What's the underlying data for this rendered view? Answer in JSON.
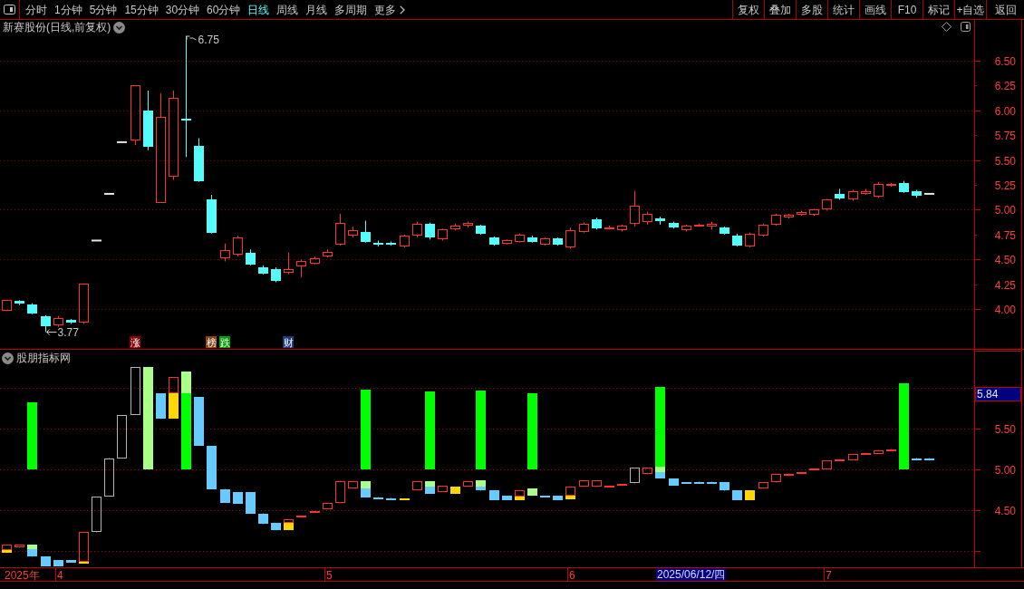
{
  "toolbar": {
    "tabs": [
      {
        "label": "分时",
        "selected": false,
        "kind": "period"
      },
      {
        "label": "1分钟",
        "selected": false,
        "kind": "period"
      },
      {
        "label": "5分钟",
        "selected": false,
        "kind": "period"
      },
      {
        "label": "15分钟",
        "selected": false,
        "kind": "period"
      },
      {
        "label": "30分钟",
        "selected": false,
        "kind": "period"
      },
      {
        "label": "60分钟",
        "selected": false,
        "kind": "period"
      },
      {
        "label": "日线",
        "selected": true,
        "kind": "period"
      },
      {
        "label": "周线",
        "selected": false,
        "kind": "period"
      },
      {
        "label": "月线",
        "selected": false,
        "kind": "period"
      },
      {
        "label": "多周期",
        "selected": false,
        "kind": "period"
      },
      {
        "label": "更多",
        "selected": false,
        "kind": "menu"
      }
    ],
    "buttons": [
      "复权",
      "叠加",
      "多股",
      "统计",
      "画线",
      "F10",
      "标记",
      "+自选",
      "返回"
    ]
  },
  "main_pane": {
    "title": "新赛股份(日线,前复权)",
    "high_label": "6.75",
    "low_label": "3.77",
    "event_tags": [
      {
        "color": "#8b0000"
      },
      {
        "color": "#8b4513"
      },
      {
        "color": "#00a000"
      },
      {
        "color": "#1e3a7a"
      }
    ],
    "chart_data": {
      "type": "candlestick",
      "ylim": [
        3.6,
        6.91
      ],
      "yticks": [
        {
          "value": 4,
          "label": "4.00"
        },
        {
          "value": 4.25,
          "label": "4.25"
        },
        {
          "value": 4.5,
          "label": "4.50"
        },
        {
          "value": 4.75,
          "label": "4.75"
        },
        {
          "value": 5,
          "label": "5.00"
        },
        {
          "value": 5.25,
          "label": "5.25"
        },
        {
          "value": 5.5,
          "label": "5.50"
        },
        {
          "value": 5.75,
          "label": "5.75"
        },
        {
          "value": 6,
          "label": "6.00"
        },
        {
          "value": 6.25,
          "label": "6.25"
        },
        {
          "value": 6.5,
          "label": "6.50"
        }
      ],
      "grid": true,
      "categories": [
        null,
        null,
        null,
        null,
        null,
        null,
        null,
        null,
        null,
        null,
        "涨",
        null,
        null,
        null,
        null,
        null,
        "榜",
        "跌",
        null,
        null,
        null,
        null,
        "财",
        null,
        null,
        null,
        null,
        null,
        null,
        null,
        null,
        null,
        null,
        null,
        null,
        null,
        null,
        null,
        null,
        null,
        null,
        null,
        null,
        null,
        null,
        null,
        null,
        null,
        null,
        null,
        null,
        null,
        null,
        null,
        null,
        null,
        null,
        null,
        null,
        null,
        null,
        null,
        null,
        null,
        null,
        null,
        null,
        null,
        null,
        null,
        null,
        null,
        null,
        null,
        null,
        null
      ],
      "ohlc": [
        [
          3.98,
          4.09,
          3.98,
          4.09
        ],
        [
          4.08,
          4.09,
          4.04,
          4.06
        ],
        [
          4.05,
          4.06,
          3.95,
          3.96
        ],
        [
          3.93,
          3.94,
          3.77,
          3.83
        ],
        [
          3.84,
          3.93,
          3.82,
          3.91
        ],
        [
          3.89,
          3.9,
          3.85,
          3.86
        ],
        [
          3.86,
          4.26,
          3.85,
          4.26
        ],
        [
          4.69,
          4.69,
          4.69,
          4.69
        ],
        [
          5.16,
          5.16,
          5.16,
          5.16
        ],
        [
          5.68,
          5.68,
          5.68,
          5.68
        ],
        [
          5.7,
          6.25,
          5.65,
          6.25
        ],
        [
          6.0,
          6.2,
          5.6,
          5.63
        ],
        [
          5.07,
          6.17,
          5.07,
          5.93
        ],
        [
          5.33,
          6.2,
          5.3,
          6.13
        ],
        [
          5.92,
          6.75,
          5.53,
          5.9
        ],
        [
          5.64,
          5.72,
          5.28,
          5.29
        ],
        [
          5.1,
          5.15,
          4.76,
          4.77
        ],
        [
          4.51,
          4.66,
          4.48,
          4.59
        ],
        [
          4.55,
          4.74,
          4.53,
          4.72
        ],
        [
          4.57,
          4.6,
          4.44,
          4.45
        ],
        [
          4.42,
          4.44,
          4.35,
          4.36
        ],
        [
          4.4,
          4.42,
          4.27,
          4.28
        ],
        [
          4.37,
          4.57,
          4.35,
          4.4
        ],
        [
          4.43,
          4.5,
          4.32,
          4.48
        ],
        [
          4.46,
          4.53,
          4.45,
          4.51
        ],
        [
          4.53,
          4.6,
          4.52,
          4.58
        ],
        [
          4.65,
          4.96,
          4.64,
          4.87
        ],
        [
          4.74,
          4.83,
          4.72,
          4.79
        ],
        [
          4.78,
          4.89,
          4.67,
          4.68
        ],
        [
          4.67,
          4.69,
          4.63,
          4.66
        ],
        [
          4.67,
          4.68,
          4.64,
          4.66
        ],
        [
          4.63,
          4.75,
          4.62,
          4.74
        ],
        [
          4.74,
          4.88,
          4.72,
          4.86
        ],
        [
          4.86,
          4.87,
          4.7,
          4.72
        ],
        [
          4.7,
          4.81,
          4.69,
          4.8
        ],
        [
          4.8,
          4.86,
          4.79,
          4.84
        ],
        [
          4.84,
          4.88,
          4.82,
          4.87
        ],
        [
          4.84,
          4.85,
          4.75,
          4.76
        ],
        [
          4.72,
          4.73,
          4.64,
          4.65
        ],
        [
          4.66,
          4.7,
          4.65,
          4.69
        ],
        [
          4.68,
          4.76,
          4.67,
          4.75
        ],
        [
          4.72,
          4.74,
          4.67,
          4.68
        ],
        [
          4.65,
          4.72,
          4.64,
          4.71
        ],
        [
          4.71,
          4.72,
          4.64,
          4.65
        ],
        [
          4.62,
          4.82,
          4.61,
          4.79
        ],
        [
          4.78,
          4.87,
          4.77,
          4.86
        ],
        [
          4.9,
          4.92,
          4.8,
          4.81
        ],
        [
          4.81,
          4.84,
          4.8,
          4.82
        ],
        [
          4.79,
          4.85,
          4.78,
          4.84
        ],
        [
          4.86,
          5.19,
          4.83,
          5.04
        ],
        [
          4.88,
          4.98,
          4.85,
          4.96
        ],
        [
          4.91,
          4.93,
          4.85,
          4.89
        ],
        [
          4.87,
          4.88,
          4.81,
          4.82
        ],
        [
          4.79,
          4.85,
          4.78,
          4.84
        ],
        [
          4.84,
          4.86,
          4.83,
          4.85
        ],
        [
          4.83,
          4.88,
          4.8,
          4.86
        ],
        [
          4.82,
          4.83,
          4.75,
          4.76
        ],
        [
          4.74,
          4.76,
          4.63,
          4.64
        ],
        [
          4.63,
          4.77,
          4.62,
          4.76
        ],
        [
          4.74,
          4.86,
          4.73,
          4.85
        ],
        [
          4.85,
          4.96,
          4.84,
          4.95
        ],
        [
          4.92,
          4.96,
          4.91,
          4.95
        ],
        [
          4.95,
          4.99,
          4.94,
          4.98
        ],
        [
          4.95,
          5.01,
          4.94,
          5.0
        ],
        [
          5.0,
          5.11,
          4.99,
          5.1
        ],
        [
          5.16,
          5.21,
          5.1,
          5.11
        ],
        [
          5.1,
          5.2,
          5.09,
          5.19
        ],
        [
          5.16,
          5.21,
          5.15,
          5.19
        ],
        [
          5.13,
          5.28,
          5.12,
          5.26
        ],
        [
          5.24,
          5.27,
          5.23,
          5.26
        ],
        [
          5.27,
          5.29,
          5.17,
          5.18
        ],
        [
          5.19,
          5.2,
          5.12,
          5.14
        ],
        [
          5.16,
          5.16,
          5.16,
          5.16
        ],
        null,
        null,
        null
      ]
    }
  },
  "indicator_pane": {
    "title": "股朋指标网",
    "cursor": {
      "date_label": "2025/06/12/四",
      "value_label": "5.84"
    },
    "chart_data": {
      "type": "bar",
      "ylim": [
        3.8,
        6.48
      ],
      "xlabel": "2025年",
      "yticks": [
        {
          "value": 4.5,
          "label": "4.50"
        },
        {
          "value": 5,
          "label": "5.00"
        },
        {
          "value": 5.5,
          "label": "5.50"
        }
      ],
      "grid": true,
      "categories": [
        null,
        null,
        null,
        null,
        "4",
        null,
        null,
        null,
        null,
        null,
        null,
        null,
        null,
        null,
        null,
        null,
        null,
        null,
        null,
        null,
        null,
        null,
        null,
        null,
        null,
        "5",
        null,
        null,
        null,
        null,
        null,
        null,
        null,
        null,
        null,
        null,
        null,
        null,
        null,
        null,
        null,
        null,
        null,
        null,
        "6",
        null,
        null,
        null,
        null,
        null,
        null,
        null,
        null,
        null,
        null,
        null,
        null,
        null,
        null,
        null,
        null,
        null,
        null,
        null,
        "7",
        null,
        null,
        null,
        null,
        null,
        null,
        null,
        null,
        null,
        null,
        null
      ],
      "series": [
        {
          "type": "candlestick",
          "ohlc": [
            [
              4.01,
              4.08,
              4.01,
              4.08
            ],
            [
              4.04,
              4.08,
              4.04,
              4.08
            ],
            [
              4.02,
              4.02,
              3.93,
              3.93
            ],
            [
              3.93,
              3.93,
              3.81,
              3.81
            ],
            [
              3.89,
              3.89,
              3.81,
              3.81
            ],
            [
              3.89,
              3.89,
              3.86,
              3.86
            ],
            [
              3.87,
              4.23,
              3.87,
              4.23
            ],
            null,
            null,
            null,
            null,
            null,
            [
              5.93,
              5.93,
              5.62,
              5.62
            ],
            [
              5.93,
              6.13,
              5.93,
              6.13
            ],
            null,
            [
              5.89,
              5.89,
              5.29,
              5.29
            ],
            [
              5.29,
              5.29,
              4.76,
              4.76
            ],
            [
              4.76,
              4.76,
              4.59,
              4.59
            ],
            [
              4.72,
              4.72,
              4.58,
              4.58
            ],
            [
              4.72,
              4.72,
              4.46,
              4.46
            ],
            [
              4.46,
              4.46,
              4.33,
              4.33
            ],
            [
              4.34,
              4.34,
              4.26,
              4.26
            ],
            [
              4.34,
              4.39,
              4.34,
              4.39
            ],
            [
              4.42,
              4.43,
              4.42,
              4.43
            ],
            [
              4.48,
              4.49,
              4.48,
              4.49
            ],
            [
              4.51,
              4.59,
              4.51,
              4.59
            ],
            [
              4.59,
              4.86,
              4.59,
              4.86
            ],
            [
              4.77,
              4.86,
              4.77,
              4.86
            ],
            [
              4.77,
              4.77,
              4.66,
              4.66
            ],
            [
              4.66,
              4.66,
              4.65,
              4.65
            ],
            [
              4.65,
              4.65,
              4.64,
              4.64
            ],
            null,
            [
              4.74,
              4.86,
              4.74,
              4.86
            ],
            [
              4.79,
              4.79,
              4.7,
              4.7
            ],
            [
              4.72,
              4.8,
              4.72,
              4.8
            ],
            null,
            [
              4.79,
              4.86,
              4.79,
              4.86
            ],
            [
              4.79,
              4.79,
              4.74,
              4.74
            ],
            [
              4.74,
              4.74,
              4.62,
              4.62
            ],
            [
              4.68,
              4.68,
              4.62,
              4.62
            ],
            [
              4.67,
              4.74,
              4.67,
              4.74
            ],
            null,
            [
              4.68,
              4.68,
              4.66,
              4.66
            ],
            [
              4.68,
              4.68,
              4.62,
              4.62
            ],
            [
              4.68,
              4.79,
              4.68,
              4.79
            ],
            [
              4.79,
              4.87,
              4.79,
              4.87
            ],
            [
              4.79,
              4.87,
              4.79,
              4.87
            ],
            [
              4.79,
              4.8,
              4.79,
              4.8
            ],
            [
              4.81,
              4.82,
              4.81,
              4.82
            ],
            null,
            [
              4.94,
              5.02,
              4.94,
              5.02
            ],
            [
              4.97,
              4.97,
              4.89,
              4.89
            ],
            [
              4.89,
              4.89,
              4.8,
              4.8
            ],
            [
              4.84,
              4.84,
              4.83,
              4.83
            ],
            [
              4.85,
              4.85,
              4.84,
              4.84
            ],
            [
              4.85,
              4.85,
              4.84,
              4.84
            ],
            [
              4.84,
              4.84,
              4.74,
              4.74
            ],
            [
              4.74,
              4.74,
              4.62,
              4.62
            ],
            null,
            [
              4.77,
              4.84,
              4.77,
              4.84
            ],
            [
              4.84,
              4.94,
              4.84,
              4.94
            ],
            [
              4.94,
              4.95,
              4.94,
              4.95
            ],
            [
              4.96,
              4.97,
              4.96,
              4.97
            ],
            [
              5.0,
              5.01,
              5.0,
              5.01
            ],
            [
              5.0,
              5.11,
              5.0,
              5.11
            ],
            [
              5.11,
              5.12,
              5.11,
              5.12
            ],
            [
              5.11,
              5.19,
              5.11,
              5.19
            ],
            [
              5.19,
              5.2,
              5.19,
              5.2
            ],
            [
              5.19,
              5.24,
              5.19,
              5.24
            ],
            [
              5.24,
              5.25,
              5.24,
              5.25
            ],
            null,
            [
              5.14,
              5.14,
              5.13,
              5.13
            ],
            [
              5.14,
              5.14,
              5.13,
              5.13
            ],
            null,
            null,
            null
          ]
        },
        {
          "type": "candlestick",
          "color": "#b4b4b4",
          "ohlc": [
            null,
            null,
            null,
            null,
            null,
            null,
            null,
            [
              4.23,
              4.67,
              4.23,
              4.67
            ],
            [
              4.67,
              5.14,
              4.67,
              5.14
            ],
            [
              5.14,
              5.67,
              5.14,
              5.67
            ],
            [
              5.67,
              6.26,
              5.67,
              6.26
            ],
            null,
            null,
            null,
            null,
            null,
            null,
            null,
            null,
            null,
            null,
            null,
            null,
            null,
            null,
            null,
            null,
            null,
            null,
            null,
            null,
            null,
            null,
            null,
            null,
            null,
            null,
            null,
            null,
            null,
            null,
            null,
            null,
            null,
            null,
            null,
            null,
            null,
            null,
            [
              4.83,
              5.02,
              4.83,
              5.02
            ],
            null,
            null,
            null,
            null,
            null,
            null,
            null,
            null,
            null,
            null,
            null,
            null,
            null,
            null,
            null,
            null,
            null,
            null,
            null,
            null,
            null,
            null,
            null,
            null,
            null,
            null
          ]
        },
        {
          "type": "bar",
          "color": "#ffd700",
          "values": [
            0.03,
            null,
            null,
            null,
            null,
            null,
            0.03,
            null,
            null,
            null,
            null,
            null,
            null,
            0.31,
            null,
            null,
            null,
            null,
            null,
            null,
            null,
            null,
            0.08,
            null,
            null,
            null,
            null,
            null,
            null,
            null,
            null,
            0.03,
            null,
            null,
            null,
            0.09,
            null,
            null,
            null,
            null,
            0.05,
            null,
            null,
            null,
            0.05,
            null,
            null,
            null,
            null,
            null,
            null,
            null,
            null,
            null,
            null,
            null,
            null,
            null,
            0.12,
            null,
            null,
            null,
            null,
            null,
            null,
            null,
            null,
            null,
            null,
            null,
            null,
            null,
            null,
            null,
            null,
            null
          ],
          "base": [
            3.98,
            null,
            null,
            null,
            null,
            null,
            3.84,
            null,
            null,
            null,
            null,
            null,
            null,
            5.62,
            null,
            null,
            null,
            null,
            null,
            null,
            null,
            null,
            4.26,
            null,
            null,
            null,
            null,
            null,
            null,
            null,
            null,
            4.62,
            null,
            null,
            null,
            4.7,
            null,
            null,
            null,
            null,
            4.62,
            null,
            null,
            null,
            4.63,
            null,
            null,
            null,
            null,
            null,
            null,
            null,
            null,
            null,
            null,
            null,
            null,
            null,
            4.62,
            null,
            null,
            null,
            null,
            null,
            null,
            null,
            null,
            null,
            null,
            null,
            null,
            null,
            null,
            null,
            null,
            null
          ]
        },
        {
          "type": "bar",
          "color": "#00ff00",
          "values": [
            null,
            null,
            0.82,
            null,
            null,
            null,
            null,
            null,
            null,
            null,
            null,
            null,
            null,
            null,
            0.93,
            null,
            null,
            null,
            null,
            null,
            null,
            null,
            null,
            null,
            null,
            null,
            null,
            null,
            0.98,
            null,
            null,
            null,
            null,
            0.96,
            null,
            null,
            null,
            0.97,
            null,
            null,
            null,
            0.94,
            null,
            null,
            null,
            null,
            null,
            null,
            null,
            null,
            null,
            0.98,
            null,
            null,
            null,
            null,
            null,
            null,
            null,
            null,
            null,
            null,
            null,
            null,
            null,
            null,
            null,
            null,
            null,
            null,
            1.06,
            null,
            null,
            null,
            null,
            null
          ],
          "base": [
            null,
            null,
            5,
            null,
            null,
            null,
            null,
            null,
            null,
            null,
            null,
            null,
            null,
            null,
            5,
            null,
            null,
            null,
            null,
            null,
            null,
            null,
            null,
            null,
            null,
            null,
            null,
            null,
            5,
            null,
            null,
            null,
            null,
            5,
            null,
            null,
            null,
            5,
            null,
            null,
            null,
            5,
            null,
            null,
            null,
            null,
            null,
            null,
            null,
            null,
            null,
            5.03,
            null,
            null,
            null,
            null,
            null,
            null,
            null,
            null,
            null,
            null,
            null,
            null,
            null,
            null,
            null,
            null,
            null,
            null,
            5,
            null,
            null,
            null,
            null,
            null
          ]
        },
        {
          "type": "bar",
          "color": "#aaff88",
          "values": [
            null,
            null,
            0.06,
            null,
            null,
            null,
            null,
            null,
            null,
            null,
            null,
            1.26,
            null,
            null,
            0.27,
            null,
            null,
            null,
            null,
            null,
            null,
            null,
            null,
            null,
            null,
            null,
            null,
            null,
            0.09,
            null,
            null,
            null,
            null,
            0.07,
            null,
            null,
            null,
            0.08,
            null,
            null,
            null,
            0.09,
            null,
            null,
            null,
            null,
            null,
            null,
            null,
            null,
            null,
            0.06,
            null,
            null,
            null,
            null,
            null,
            null,
            null,
            null,
            null,
            null,
            null,
            null,
            null,
            null,
            null,
            null,
            null,
            null,
            null,
            null,
            null,
            null,
            null,
            null
          ],
          "base": [
            null,
            null,
            4.02,
            null,
            null,
            null,
            null,
            null,
            null,
            null,
            null,
            5,
            null,
            null,
            5.93,
            null,
            null,
            null,
            null,
            null,
            null,
            null,
            null,
            null,
            null,
            null,
            null,
            null,
            4.77,
            null,
            null,
            null,
            null,
            4.79,
            null,
            null,
            null,
            4.79,
            null,
            null,
            null,
            4.68,
            null,
            null,
            null,
            null,
            null,
            null,
            null,
            null,
            null,
            4.97,
            null,
            null,
            null,
            null,
            null,
            null,
            null,
            null,
            null,
            null,
            null,
            null,
            null,
            null,
            null,
            null,
            null,
            null,
            null,
            null,
            null,
            null,
            null,
            null
          ]
        }
      ]
    }
  }
}
